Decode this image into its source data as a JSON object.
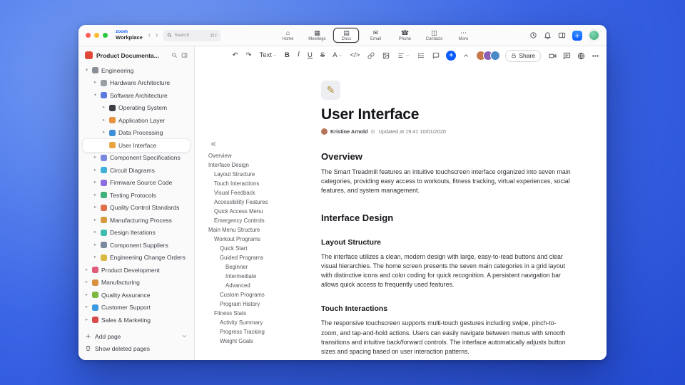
{
  "accent_color": "#0b5cff",
  "topnav": {
    "brand": {
      "line1": "zoom",
      "line2": "Workplace"
    },
    "search": {
      "placeholder": "Search",
      "shortcut": "⌘F"
    },
    "tabs": [
      {
        "label": "Home",
        "icon": "home",
        "glyph": "⌂",
        "active": false
      },
      {
        "label": "Meetings",
        "icon": "calendar",
        "glyph": "▦",
        "active": false
      },
      {
        "label": "Docs",
        "icon": "document",
        "glyph": "▤",
        "active": true
      },
      {
        "label": "Email",
        "icon": "mail",
        "glyph": "✉",
        "active": false
      },
      {
        "label": "Phone",
        "icon": "phone",
        "glyph": "☎",
        "active": false
      },
      {
        "label": "Contacts",
        "icon": "contacts",
        "glyph": "◫",
        "active": false
      },
      {
        "label": "More",
        "icon": "more",
        "glyph": "⋯",
        "active": false
      }
    ],
    "actions": [
      {
        "name": "history",
        "icon": "clock",
        "accent": false
      },
      {
        "name": "notifications",
        "icon": "bell",
        "accent": false
      },
      {
        "name": "side-panel",
        "icon": "panel",
        "accent": false
      },
      {
        "name": "new",
        "icon": "plus",
        "accent": true
      }
    ],
    "avatar_color": "#3fa87a"
  },
  "sidebar": {
    "title": "Product Documenta...",
    "items": [
      {
        "label": "Engineering",
        "level": 0,
        "chevron": "down",
        "color": "#8a8f96",
        "selected": false
      },
      {
        "label": "Hardware Architecture",
        "level": 1,
        "chevron": "right",
        "color": "#9a9fa6",
        "selected": false
      },
      {
        "label": "Software Architecture",
        "level": 1,
        "chevron": "down",
        "color": "#5b7be0",
        "selected": false
      },
      {
        "label": "Operating System",
        "level": 2,
        "chevron": "right",
        "color": "#3a3d44",
        "selected": false
      },
      {
        "label": "Application Layer",
        "level": 2,
        "chevron": "right",
        "color": "#e8913f",
        "selected": false
      },
      {
        "label": "Data Processing",
        "level": 2,
        "chevron": "right",
        "color": "#3f8fd8",
        "selected": false
      },
      {
        "label": "User Interface",
        "level": 2,
        "chevron": null,
        "color": "#e8a53f",
        "selected": true
      },
      {
        "label": "Component Specifications",
        "level": 1,
        "chevron": "right",
        "color": "#7b86e0",
        "selected": false
      },
      {
        "label": "Circuit Diagrams",
        "level": 1,
        "chevron": "right",
        "color": "#3fb0d8",
        "selected": false
      },
      {
        "label": "Firmware Source Code",
        "level": 1,
        "chevron": "right",
        "color": "#8f6be0",
        "selected": false
      },
      {
        "label": "Testing Protocols",
        "level": 1,
        "chevron": "right",
        "color": "#3fb07a",
        "selected": false
      },
      {
        "label": "Quality Control Standards",
        "level": 1,
        "chevron": "right",
        "color": "#e0704a",
        "selected": false
      },
      {
        "label": "Manufacturing Process",
        "level": 1,
        "chevron": "right",
        "color": "#d89a3f",
        "selected": false
      },
      {
        "label": "Design Iterations",
        "level": 1,
        "chevron": "right",
        "color": "#3fbcb0",
        "selected": false
      },
      {
        "label": "Component Suppliers",
        "level": 1,
        "chevron": "right",
        "color": "#7a8a9a",
        "selected": false
      },
      {
        "label": "Engineering Change Orders",
        "level": 1,
        "chevron": "right",
        "color": "#d8b83f",
        "selected": false
      },
      {
        "label": "Product Development",
        "level": 0,
        "chevron": "right",
        "color": "#e05a7a",
        "selected": false
      },
      {
        "label": "Manufacturing",
        "level": 0,
        "chevron": "right",
        "color": "#d8913f",
        "selected": false
      },
      {
        "label": "Quality Assurance",
        "level": 0,
        "chevron": "right",
        "color": "#7ab83f",
        "selected": false
      },
      {
        "label": "Customer Support",
        "level": 0,
        "chevron": "right",
        "color": "#3f9be0",
        "selected": false
      },
      {
        "label": "Sales & Marketing",
        "level": 0,
        "chevron": "right",
        "color": "#d84a4a",
        "selected": false
      }
    ],
    "add_page_label": "Add page",
    "show_deleted_label": "Show deleted pages"
  },
  "toolbar": {
    "buttons": [
      {
        "name": "undo",
        "glyph": "↶"
      },
      {
        "name": "redo",
        "glyph": "↷"
      },
      {
        "name": "text-style",
        "label": "Text",
        "caret": true
      },
      {
        "name": "bold",
        "glyph": "B",
        "cls": "g-b"
      },
      {
        "name": "italic",
        "glyph": "I",
        "cls": "g-i"
      },
      {
        "name": "underline",
        "glyph": "U",
        "cls": "g-u"
      },
      {
        "name": "strikethrough",
        "glyph": "S",
        "cls": "g-s"
      },
      {
        "name": "text-color",
        "glyph": "A",
        "caret": true
      },
      {
        "name": "code",
        "glyph": "</>"
      },
      {
        "name": "link",
        "icon": "link"
      },
      {
        "name": "image",
        "icon": "image"
      },
      {
        "name": "align",
        "icon": "align",
        "caret": true
      },
      {
        "name": "list",
        "icon": "list"
      },
      {
        "name": "comment",
        "icon": "comment"
      },
      {
        "name": "insert",
        "glyph": "+",
        "accent": true
      },
      {
        "name": "collapse-toolbar",
        "icon": "chevron-up"
      }
    ],
    "avatars": [
      "#c9784a",
      "#8a5fb8",
      "#4a8ac7"
    ],
    "share_label": "Share",
    "right_actions": [
      {
        "name": "video",
        "icon": "camera"
      },
      {
        "name": "chat",
        "icon": "chat"
      },
      {
        "name": "web",
        "icon": "globe"
      },
      {
        "name": "more-options",
        "icon": "dots"
      }
    ]
  },
  "outline": {
    "items": [
      {
        "label": "Overview",
        "level": 0
      },
      {
        "label": "Interface Design",
        "level": 0
      },
      {
        "label": "Layout Structure",
        "level": 1
      },
      {
        "label": "Touch Interactions",
        "level": 1
      },
      {
        "label": "Visual Feedback",
        "level": 1
      },
      {
        "label": "Accessibility Features",
        "level": 1
      },
      {
        "label": "Quick Access Menu",
        "level": 1
      },
      {
        "label": "Emergency Controls",
        "level": 1
      },
      {
        "label": "Main Menu Structure",
        "level": 0
      },
      {
        "label": "Workout Programs",
        "level": 1
      },
      {
        "label": "Quick Start",
        "level": 2
      },
      {
        "label": "Guided Programs",
        "level": 2
      },
      {
        "label": "Beginner",
        "level": 3
      },
      {
        "label": "Intermediate",
        "level": 3
      },
      {
        "label": "Advanced",
        "level": 3
      },
      {
        "label": "Custom Programs",
        "level": 2
      },
      {
        "label": "Program History",
        "level": 2
      },
      {
        "label": "Fitness Stats",
        "level": 1
      },
      {
        "label": "Activity Summary",
        "level": 2
      },
      {
        "label": "Progress Tracking",
        "level": 2
      },
      {
        "label": "Weight Goals",
        "level": 2
      }
    ]
  },
  "doc": {
    "icon_glyph": "✎",
    "title": "User Interface",
    "author": "Kristine Arnold",
    "updated": "Updated at 19:41 10/01/2020",
    "sections": [
      {
        "type": "h2",
        "text": "Overview"
      },
      {
        "type": "p",
        "text": "The Smart Treadmill features an intuitive touchscreen interface organized into seven main categories, providing easy access to workouts, fitness tracking, virtual experiences, social features, and system management."
      },
      {
        "type": "h2",
        "text": "Interface Design"
      },
      {
        "type": "h3",
        "text": "Layout Structure"
      },
      {
        "type": "p",
        "text": "The interface utilizes a clean, modern design with large, easy-to-read buttons and clear visual hierarchies. The home screen presents the seven main categories in a grid layout with distinctive icons and color coding for quick recognition. A persistent navigation bar allows quick access to frequently used features."
      },
      {
        "type": "h3",
        "text": "Touch Interactions"
      },
      {
        "type": "p",
        "text": "The responsive touchscreen supports multi-touch gestures including swipe, pinch-to-zoom, and tap-and-hold actions. Users can easily navigate between menus with smooth transitions and intuitive back/forward controls. The interface automatically adjusts button sizes and spacing based on user interaction patterns."
      }
    ]
  }
}
